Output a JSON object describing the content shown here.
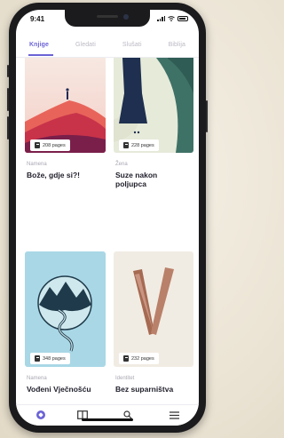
{
  "status": {
    "time": "9:41"
  },
  "tabs": [
    {
      "label": "Knjige",
      "active": true
    },
    {
      "label": "Gledati",
      "active": false
    },
    {
      "label": "Slušati",
      "active": false
    },
    {
      "label": "Biblija",
      "active": false
    }
  ],
  "books": [
    {
      "category": "Namena",
      "title": "Bože, gdje si?!",
      "pages": "208 pages"
    },
    {
      "category": "Žena",
      "title": "Suze nakon poljupca",
      "pages": "228 pages"
    },
    {
      "category": "Namena",
      "title": "Vođeni Vječnošću",
      "pages": "348 pages"
    },
    {
      "category": "Identitet",
      "title": "Bez suparništva",
      "pages": "232 pages"
    }
  ],
  "nav": [
    {
      "icon": "compass-icon",
      "active": true
    },
    {
      "icon": "book-icon",
      "active": false
    },
    {
      "icon": "search-icon",
      "active": false
    },
    {
      "icon": "menu-icon",
      "active": false
    }
  ],
  "colors": {
    "accent": "#6b63d6"
  }
}
